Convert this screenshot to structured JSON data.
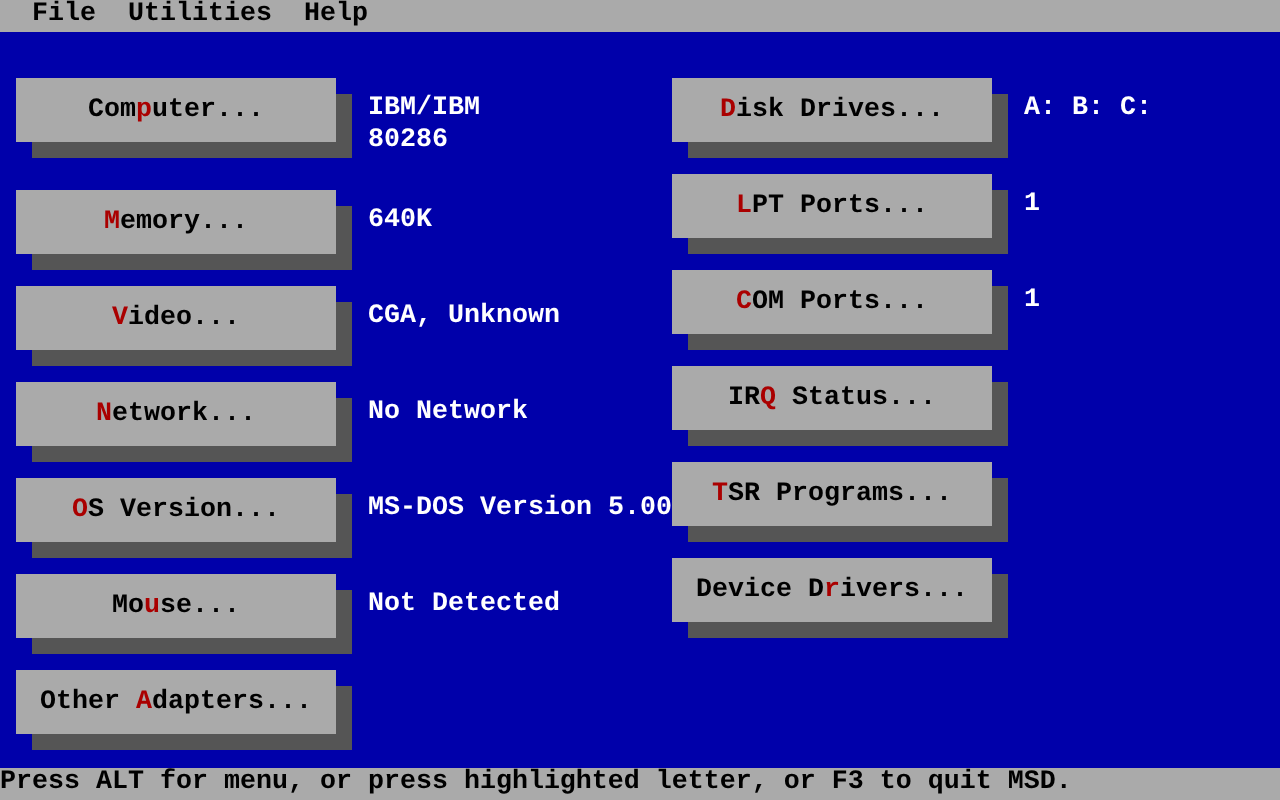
{
  "menu_bar": [
    {
      "label": "File"
    },
    {
      "label": "Utilities"
    },
    {
      "label": "Help"
    }
  ],
  "left_column": [
    {
      "button": {
        "before": "Com",
        "hotkey": "p",
        "after": "uter..."
      },
      "value": "IBM/IBM\n80286"
    },
    {
      "button": {
        "hotkey": "M",
        "after": "emory..."
      },
      "value": "640K"
    },
    {
      "button": {
        "hotkey": "V",
        "after": "ideo..."
      },
      "value": "CGA, Unknown"
    },
    {
      "button": {
        "hotkey": "N",
        "after": "etwork..."
      },
      "value": "No Network"
    },
    {
      "button": {
        "hotkey": "O",
        "after": "S Version..."
      },
      "value": "MS-DOS Version 5.00"
    },
    {
      "button": {
        "before": "Mo",
        "hotkey": "u",
        "after": "se..."
      },
      "value": "Not Detected"
    },
    {
      "button": {
        "before": "Other ",
        "hotkey": "A",
        "after": "dapters..."
      }
    }
  ],
  "right_column": [
    {
      "button": {
        "hotkey": "D",
        "after": "isk Drives..."
      },
      "value": "A: B: C:"
    },
    {
      "button": {
        "hotkey": "L",
        "after": "PT Ports..."
      },
      "value": "1"
    },
    {
      "button": {
        "hotkey": "C",
        "after": "OM Ports..."
      },
      "value": "1"
    },
    {
      "button": {
        "before": "IR",
        "hotkey": "Q",
        "after": " Status..."
      }
    },
    {
      "button": {
        "hotkey": "T",
        "after": "SR Programs..."
      }
    },
    {
      "button": {
        "before": "Device D",
        "hotkey": "r",
        "after": "ivers..."
      }
    }
  ],
  "status_bar": "Press ALT for menu, or press highlighted letter, or F3 to quit MSD."
}
